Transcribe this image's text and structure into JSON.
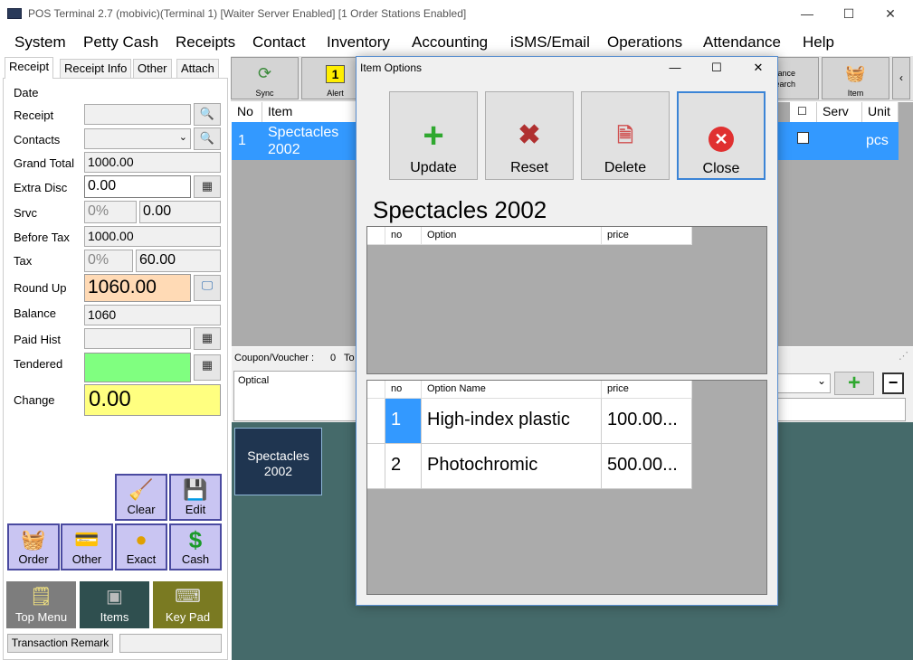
{
  "window": {
    "title": "POS Terminal 2.7 (mobivic)(Terminal 1) [Waiter Server Enabled] [1 Order Stations Enabled]",
    "minimize": "—",
    "maximize": "☐",
    "close": "✕"
  },
  "menu": [
    "System",
    "Petty Cash",
    "Receipts",
    "Contact",
    "Inventory",
    "Accounting",
    "iSMS/Email",
    "Operations",
    "Attendance",
    "Help"
  ],
  "left_tabs": [
    "Receipt",
    "Receipt Info",
    "Other",
    "Attach"
  ],
  "fields": {
    "date_label": "Date",
    "receipt_label": "Receipt",
    "contacts_label": "Contacts",
    "grand_total_label": "Grand Total",
    "grand_total": "1000.00",
    "extra_disc_label": "Extra Disc",
    "extra_disc": "0.00",
    "srvc_label": "Srvc",
    "srvc_pct": "0%",
    "srvc_value": "0.00",
    "before_tax_label": "Before Tax",
    "before_tax": "1000.00",
    "tax_label": "Tax",
    "tax_pct": "0%",
    "tax_value": "60.00",
    "round_up_label": "Round Up",
    "round_up": "1060.00",
    "balance_label": "Balance",
    "balance": "1060",
    "paid_hist_label": "Paid Hist",
    "tendered_label": "Tendered",
    "change_label": "Change",
    "change": "0.00"
  },
  "action_buttons": {
    "clear": "Clear",
    "edit": "Edit",
    "order": "Order",
    "other": "Other",
    "exact": "Exact",
    "cash": "Cash"
  },
  "nav_buttons": {
    "top_menu": "Top Menu",
    "items": "Items",
    "key_pad": "Key Pad"
  },
  "transaction_remark": "Transaction Remark",
  "toolbar": {
    "sync": "Sync",
    "alert": "Alert",
    "alert_count": "1",
    "search": "earch",
    "search_top": "vance",
    "item": "Item"
  },
  "main_grid": {
    "headers": {
      "no": "No",
      "item": "Item",
      "serv": "Serv",
      "unit": "Unit"
    },
    "row": {
      "no": "1",
      "item": "Spectacles\n2002",
      "unit": "pcs"
    }
  },
  "coupon": {
    "label": "Coupon/Voucher :",
    "value": "0",
    "to": "To"
  },
  "remark": "Optical",
  "item_tile": "Spectacles\n2002",
  "dialog": {
    "title": "Item Options",
    "buttons": {
      "update": "Update",
      "reset": "Reset",
      "delete": "Delete",
      "close": "Close"
    },
    "heading": "Spectacles 2002",
    "grid1_headers": {
      "no": "no",
      "option": "Option",
      "price": "price"
    },
    "grid2_headers": {
      "no": "no",
      "option_name": "Option Name",
      "price": "price"
    },
    "options": [
      {
        "no": "1",
        "name": "High-index plastic",
        "price": "100.00..."
      },
      {
        "no": "2",
        "name": "Photochromic",
        "price": "500.00..."
      }
    ]
  },
  "colors": {
    "selection": "#3399ff",
    "round_up_bg": "#ffdab5",
    "tendered_bg": "#80ff80",
    "change_bg": "#ffff80",
    "action_btn": "#c9c5f2",
    "item_area": "#456a6a"
  }
}
